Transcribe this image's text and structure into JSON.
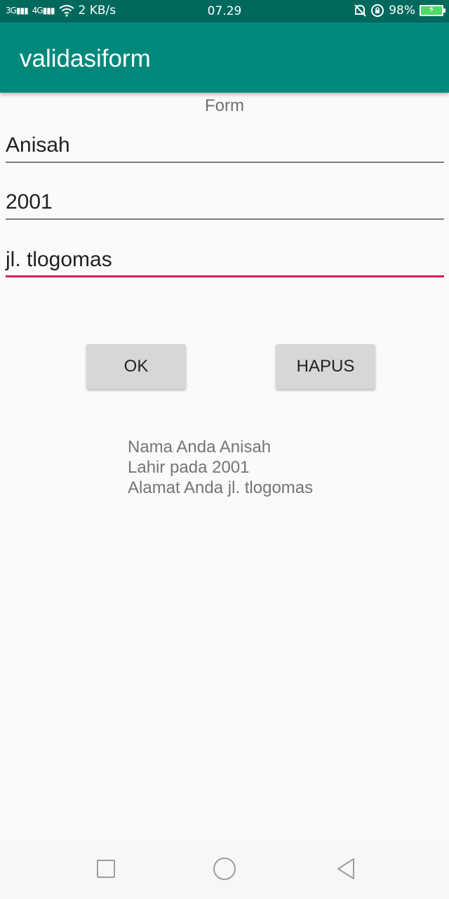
{
  "status_bar": {
    "signal1": "3G",
    "signal2": "4G",
    "speed": "2 KB/s",
    "time": "07.29",
    "battery": "98%"
  },
  "app_bar": {
    "title": "validasiform"
  },
  "form": {
    "label": "Form",
    "name_value": "Anisah",
    "year_value": "2001",
    "address_value": "jl. tlogomas"
  },
  "buttons": {
    "ok": "OK",
    "clear": "HAPUS"
  },
  "result": {
    "line1": "Nama Anda Anisah",
    "line2": "Lahir pada 2001",
    "line3": "Alamat Anda jl. tlogomas"
  },
  "colors": {
    "app_bar": "#00897b",
    "status_bar": "#00695c",
    "accent": "#d81b60"
  }
}
